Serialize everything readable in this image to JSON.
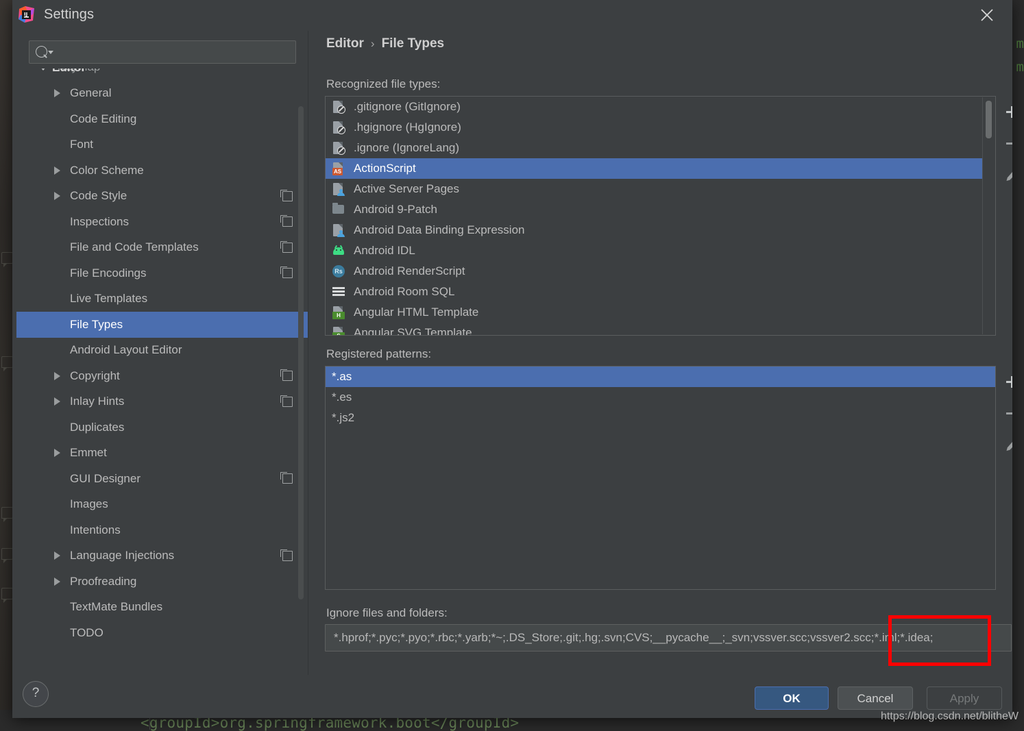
{
  "window": {
    "title": "Settings",
    "app_icon": "intellij-idea-icon",
    "close_icon": "close-icon"
  },
  "background": {
    "code_line": "<groupId>org.springframework.boot</groupId>",
    "right_fragment_a": "m",
    "right_fragment_b": "m"
  },
  "sidebar": {
    "search": {
      "value": "",
      "placeholder": "",
      "icon": "search-icon"
    },
    "cut_off_item_label": "Keymap",
    "items": [
      {
        "label": "Editor",
        "level": 0,
        "expanded": true,
        "arrow": "down",
        "badge": false,
        "selected": false
      },
      {
        "label": "General",
        "level": 1,
        "expanded": false,
        "arrow": "right",
        "badge": false,
        "selected": false
      },
      {
        "label": "Code Editing",
        "level": 1,
        "expanded": false,
        "arrow": "none",
        "badge": false,
        "selected": false
      },
      {
        "label": "Font",
        "level": 1,
        "expanded": false,
        "arrow": "none",
        "badge": false,
        "selected": false
      },
      {
        "label": "Color Scheme",
        "level": 1,
        "expanded": false,
        "arrow": "right",
        "badge": false,
        "selected": false
      },
      {
        "label": "Code Style",
        "level": 1,
        "expanded": false,
        "arrow": "right",
        "badge": true,
        "selected": false
      },
      {
        "label": "Inspections",
        "level": 1,
        "expanded": false,
        "arrow": "none",
        "badge": true,
        "selected": false
      },
      {
        "label": "File and Code Templates",
        "level": 1,
        "expanded": false,
        "arrow": "none",
        "badge": true,
        "selected": false
      },
      {
        "label": "File Encodings",
        "level": 1,
        "expanded": false,
        "arrow": "none",
        "badge": true,
        "selected": false
      },
      {
        "label": "Live Templates",
        "level": 1,
        "expanded": false,
        "arrow": "none",
        "badge": false,
        "selected": false
      },
      {
        "label": "File Types",
        "level": 1,
        "expanded": false,
        "arrow": "none",
        "badge": false,
        "selected": true
      },
      {
        "label": "Android Layout Editor",
        "level": 1,
        "expanded": false,
        "arrow": "none",
        "badge": false,
        "selected": false
      },
      {
        "label": "Copyright",
        "level": 1,
        "expanded": false,
        "arrow": "right",
        "badge": true,
        "selected": false
      },
      {
        "label": "Inlay Hints",
        "level": 1,
        "expanded": false,
        "arrow": "right",
        "badge": true,
        "selected": false
      },
      {
        "label": "Duplicates",
        "level": 1,
        "expanded": false,
        "arrow": "none",
        "badge": false,
        "selected": false
      },
      {
        "label": "Emmet",
        "level": 1,
        "expanded": false,
        "arrow": "right",
        "badge": false,
        "selected": false
      },
      {
        "label": "GUI Designer",
        "level": 1,
        "expanded": false,
        "arrow": "none",
        "badge": true,
        "selected": false
      },
      {
        "label": "Images",
        "level": 1,
        "expanded": false,
        "arrow": "none",
        "badge": false,
        "selected": false
      },
      {
        "label": "Intentions",
        "level": 1,
        "expanded": false,
        "arrow": "none",
        "badge": false,
        "selected": false
      },
      {
        "label": "Language Injections",
        "level": 1,
        "expanded": false,
        "arrow": "right",
        "badge": true,
        "selected": false
      },
      {
        "label": "Proofreading",
        "level": 1,
        "expanded": false,
        "arrow": "right",
        "badge": false,
        "selected": false
      },
      {
        "label": "TextMate Bundles",
        "level": 1,
        "expanded": false,
        "arrow": "none",
        "badge": false,
        "selected": false
      },
      {
        "label": "TODO",
        "level": 1,
        "expanded": false,
        "arrow": "none",
        "badge": false,
        "selected": false
      }
    ]
  },
  "main": {
    "breadcrumb": {
      "parent": "Editor",
      "separator": "›",
      "current": "File Types"
    },
    "recognized_label": "Recognized file types:",
    "file_types": [
      {
        "name": ".gitignore (GitIgnore)",
        "icon": "ignore-file-icon",
        "selected": false
      },
      {
        "name": ".hgignore (HgIgnore)",
        "icon": "ignore-file-icon",
        "selected": false
      },
      {
        "name": ".ignore (IgnoreLang)",
        "icon": "ignore-file-icon",
        "selected": false
      },
      {
        "name": "ActionScript",
        "icon": "actionscript-file-icon",
        "selected": true
      },
      {
        "name": "Active Server Pages",
        "icon": "asp-file-icon",
        "selected": false
      },
      {
        "name": "Android 9-Patch",
        "icon": "folder-icon",
        "selected": false
      },
      {
        "name": "Android Data Binding Expression",
        "icon": "asp-file-icon",
        "selected": false
      },
      {
        "name": "Android IDL",
        "icon": "android-robot-icon",
        "selected": false
      },
      {
        "name": "Android RenderScript",
        "icon": "renderscript-icon",
        "selected": false
      },
      {
        "name": "Android Room SQL",
        "icon": "sql-table-icon",
        "selected": false
      },
      {
        "name": "Angular HTML Template",
        "icon": "html-file-icon",
        "selected": false
      },
      {
        "name": "Angular SVG Template",
        "icon": "svg-file-icon",
        "selected": false
      }
    ],
    "filetypes_toolbar": [
      {
        "name": "add-file-type-button",
        "icon": "plus-icon",
        "enabled": true
      },
      {
        "name": "remove-file-type-button",
        "icon": "minus-icon",
        "enabled": false
      },
      {
        "name": "edit-file-type-button",
        "icon": "pencil-icon",
        "enabled": true
      }
    ],
    "patterns_label": "Registered patterns:",
    "patterns": [
      {
        "value": "*.as",
        "selected": true
      },
      {
        "value": "*.es",
        "selected": false
      },
      {
        "value": "*.js2",
        "selected": false
      }
    ],
    "patterns_toolbar": [
      {
        "name": "add-pattern-button",
        "icon": "plus-icon",
        "enabled": true
      },
      {
        "name": "remove-pattern-button",
        "icon": "minus-icon",
        "enabled": false
      },
      {
        "name": "edit-pattern-button",
        "icon": "pencil-icon",
        "enabled": true
      }
    ],
    "ignore_label": "Ignore files and folders:",
    "ignore_value": "*.hprof;*.pyc;*.pyo;*.rbc;*.yarb;*~;.DS_Store;.git;.hg;.svn;CVS;__pycache__;_svn;vssver.scc;vssver2.scc;*.iml;*.idea;",
    "annotation": {
      "shape": "rectangle",
      "color": "#fe0000",
      "targets": "*.iml;*.idea;"
    }
  },
  "footer": {
    "help_label": "?",
    "ok_label": "OK",
    "cancel_label": "Cancel",
    "apply_label": "Apply",
    "apply_enabled": false
  },
  "watermark": "https://blog.csdn.net/blitheW",
  "colors": {
    "selection_blue": "#4b6eaf",
    "dialog_bg": "#3c3f41",
    "field_bg": "#45494a",
    "annotation_red": "#fe0000",
    "ok_button": "#365880"
  }
}
